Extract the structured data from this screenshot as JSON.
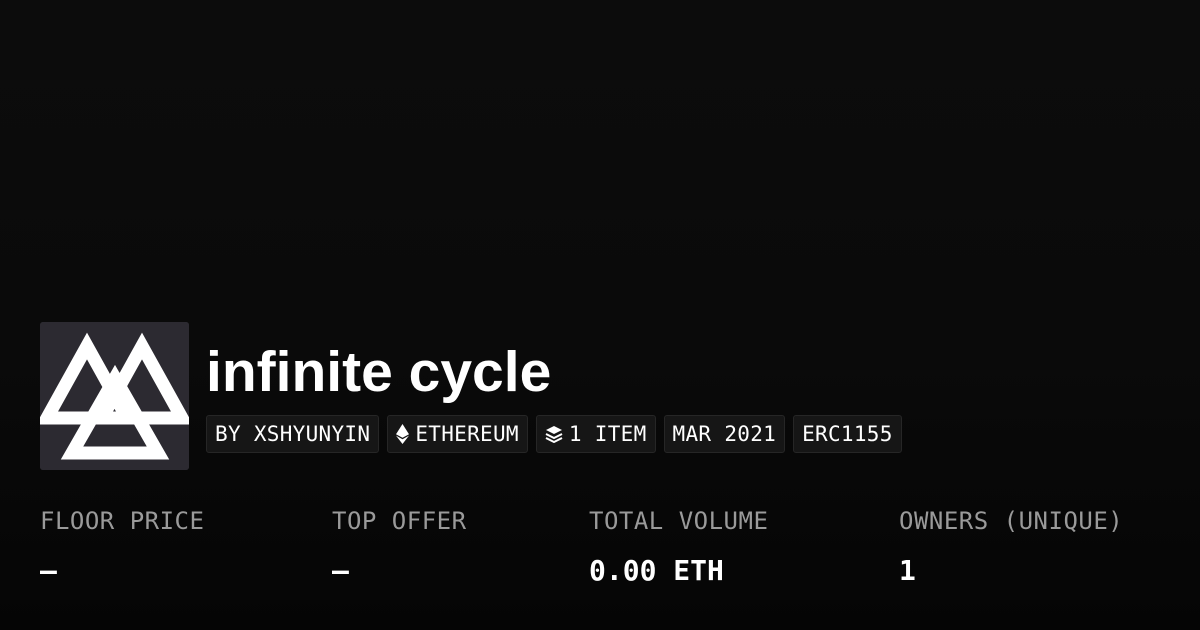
{
  "collection": {
    "name": "infinite cycle",
    "logo_icon": "triangle-knot-logo-icon",
    "chips": [
      {
        "icon": null,
        "label": "BY XSHYUNYIN"
      },
      {
        "icon": "ethereum-icon",
        "label": "ETHEREUM"
      },
      {
        "icon": "layers-icon",
        "label": "1 ITEM"
      },
      {
        "icon": null,
        "label": "MAR 2021"
      },
      {
        "icon": null,
        "label": "ERC1155"
      }
    ]
  },
  "stats": [
    {
      "label": "FLOOR PRICE",
      "value": "—"
    },
    {
      "label": "TOP OFFER",
      "value": "—"
    },
    {
      "label": "TOTAL VOLUME",
      "value": "0.00 ETH"
    },
    {
      "label": "OWNERS (UNIQUE)",
      "value": "1"
    }
  ],
  "colors": {
    "background": "#0a0a0a",
    "text_primary": "#ffffff",
    "text_secondary": "#9a9a9a",
    "chip_background": "#161616",
    "logo_tile": "#2c2a31"
  }
}
